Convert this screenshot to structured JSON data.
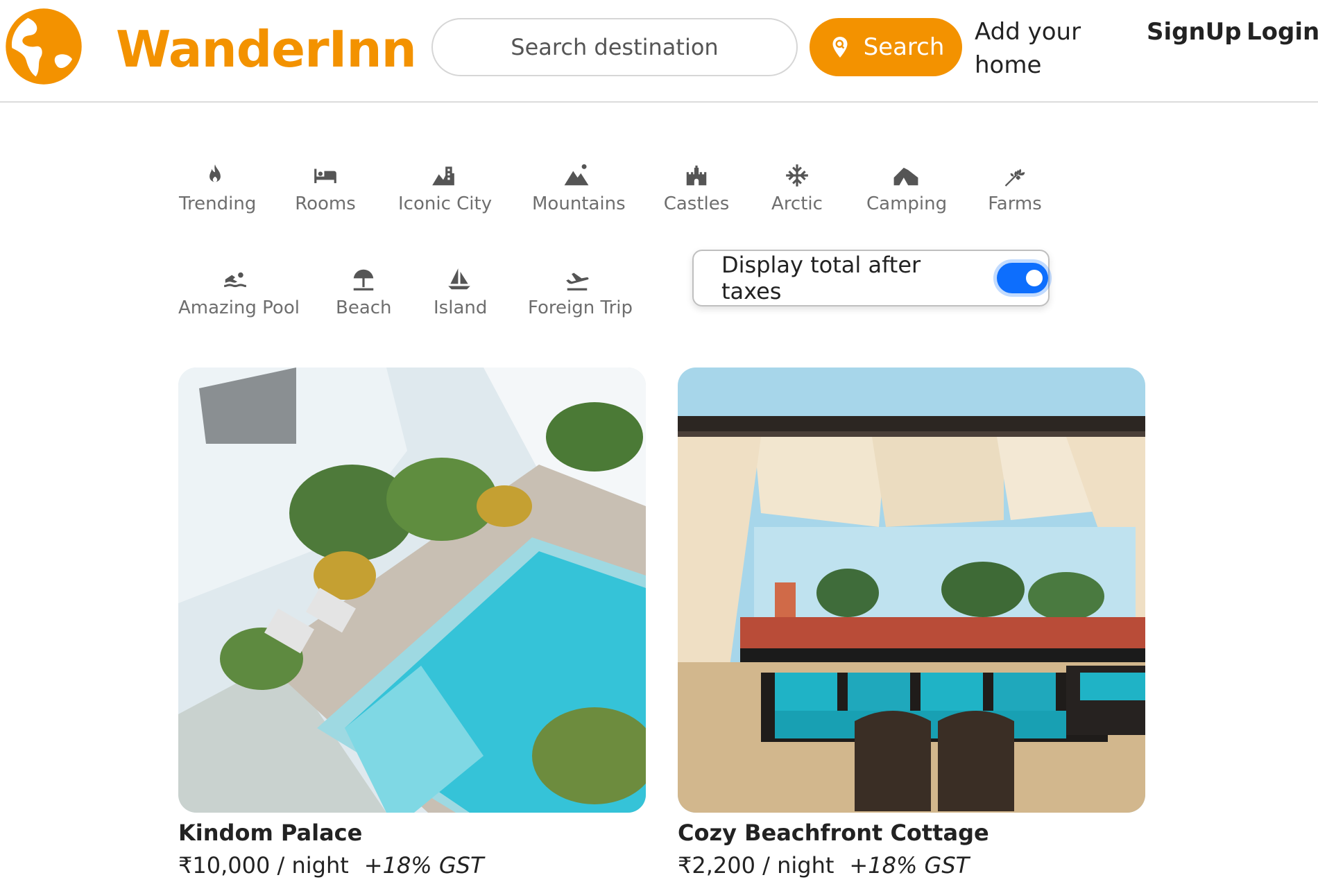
{
  "header": {
    "brand": "WanderInn",
    "search_placeholder": "Search destination",
    "search_button": "Search",
    "add_home": "Add your home",
    "signup": "SignUp",
    "login": "Login"
  },
  "categories": [
    {
      "label": "Trending",
      "icon": "fire-icon"
    },
    {
      "label": "Rooms",
      "icon": "bed-icon"
    },
    {
      "label": "Iconic City",
      "icon": "city-icon"
    },
    {
      "label": "Mountains",
      "icon": "mountain-icon"
    },
    {
      "label": "Castles",
      "icon": "castle-icon"
    },
    {
      "label": "Arctic",
      "icon": "snowflake-icon"
    },
    {
      "label": "Camping",
      "icon": "tent-icon"
    },
    {
      "label": "Farms",
      "icon": "wheat-icon"
    },
    {
      "label": "Amazing Pool",
      "icon": "swimmer-icon"
    },
    {
      "label": "Beach",
      "icon": "umbrella-beach-icon"
    },
    {
      "label": "Island",
      "icon": "sailboat-icon"
    },
    {
      "label": "Foreign Trip",
      "icon": "plane-icon"
    }
  ],
  "tax_toggle": {
    "label": "Display total after taxes",
    "checked": true
  },
  "listings": [
    {
      "title": "Kindom Palace",
      "price": "₹10,000 / night",
      "gst": "+18% GST"
    },
    {
      "title": "Cozy Beachfront Cottage",
      "price": "₹2,200 / night",
      "gst": "+18% GST"
    }
  ],
  "colors": {
    "brand": "#f39200",
    "toggle": "#0d6efd"
  }
}
